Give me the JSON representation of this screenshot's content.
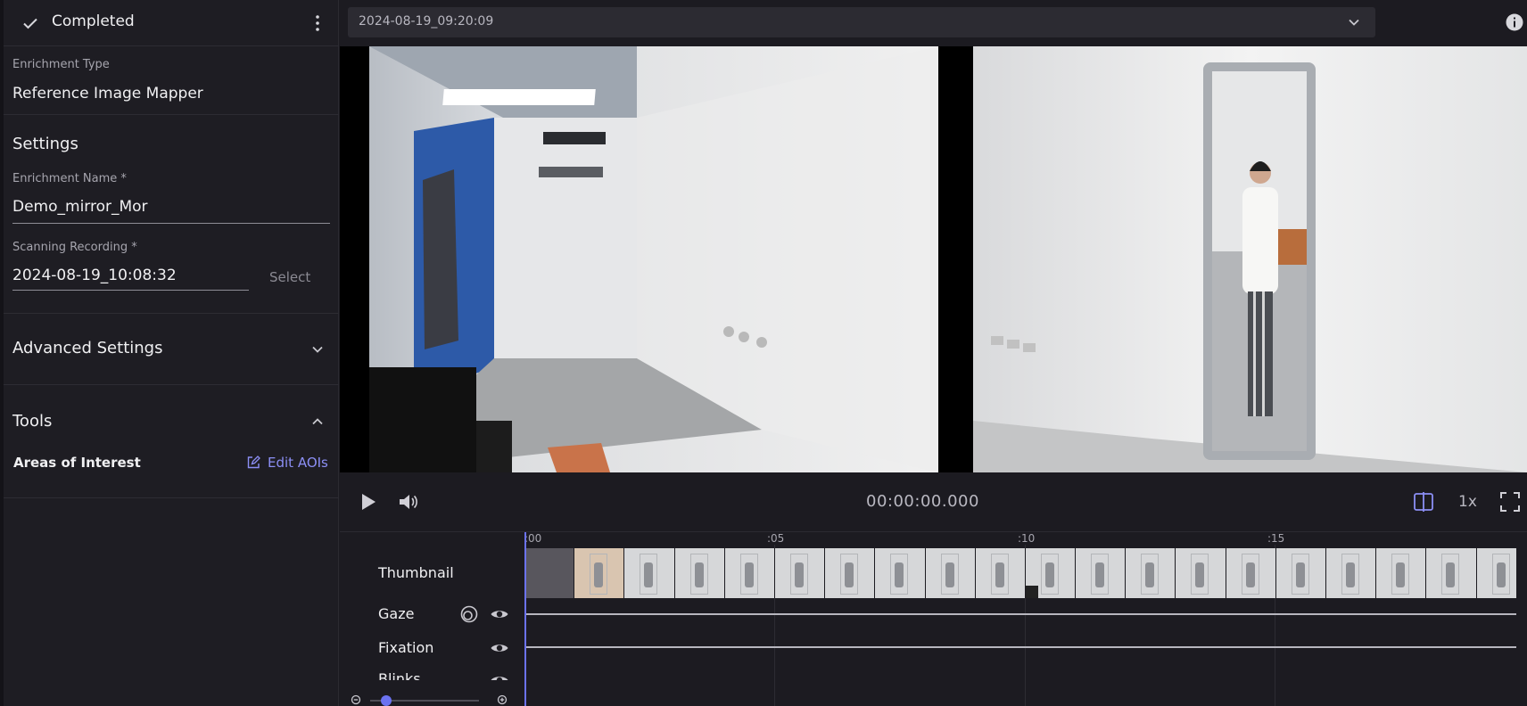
{
  "sidebar": {
    "status": "Completed",
    "enrichment_type_label": "Enrichment Type",
    "enrichment_type": "Reference Image Mapper",
    "settings_title": "Settings",
    "name_label": "Enrichment Name *",
    "name_value": "Demo_mirror_Mor",
    "scanning_label": "Scanning Recording *",
    "scanning_value": "2024-08-19_10:08:32",
    "select_label": "Select",
    "advanced_title": "Advanced Settings",
    "tools_title": "Tools",
    "aoi_label": "Areas of Interest",
    "edit_aoi_label": "Edit AOIs"
  },
  "topbar": {
    "recording": "2024-08-19_09:20:09"
  },
  "player": {
    "timecode": "00:00:00.000",
    "speed": "1x"
  },
  "timeline": {
    "ruler": [
      ":00",
      ":05",
      ":10",
      ":15"
    ],
    "tracks": {
      "thumbnail": "Thumbnail",
      "gaze": "Gaze",
      "fixation": "Fixation",
      "blinks": "Blinks"
    }
  },
  "colors": {
    "accent": "#6b72f0",
    "link": "#8c8ff5",
    "background": "#1c1b21"
  }
}
